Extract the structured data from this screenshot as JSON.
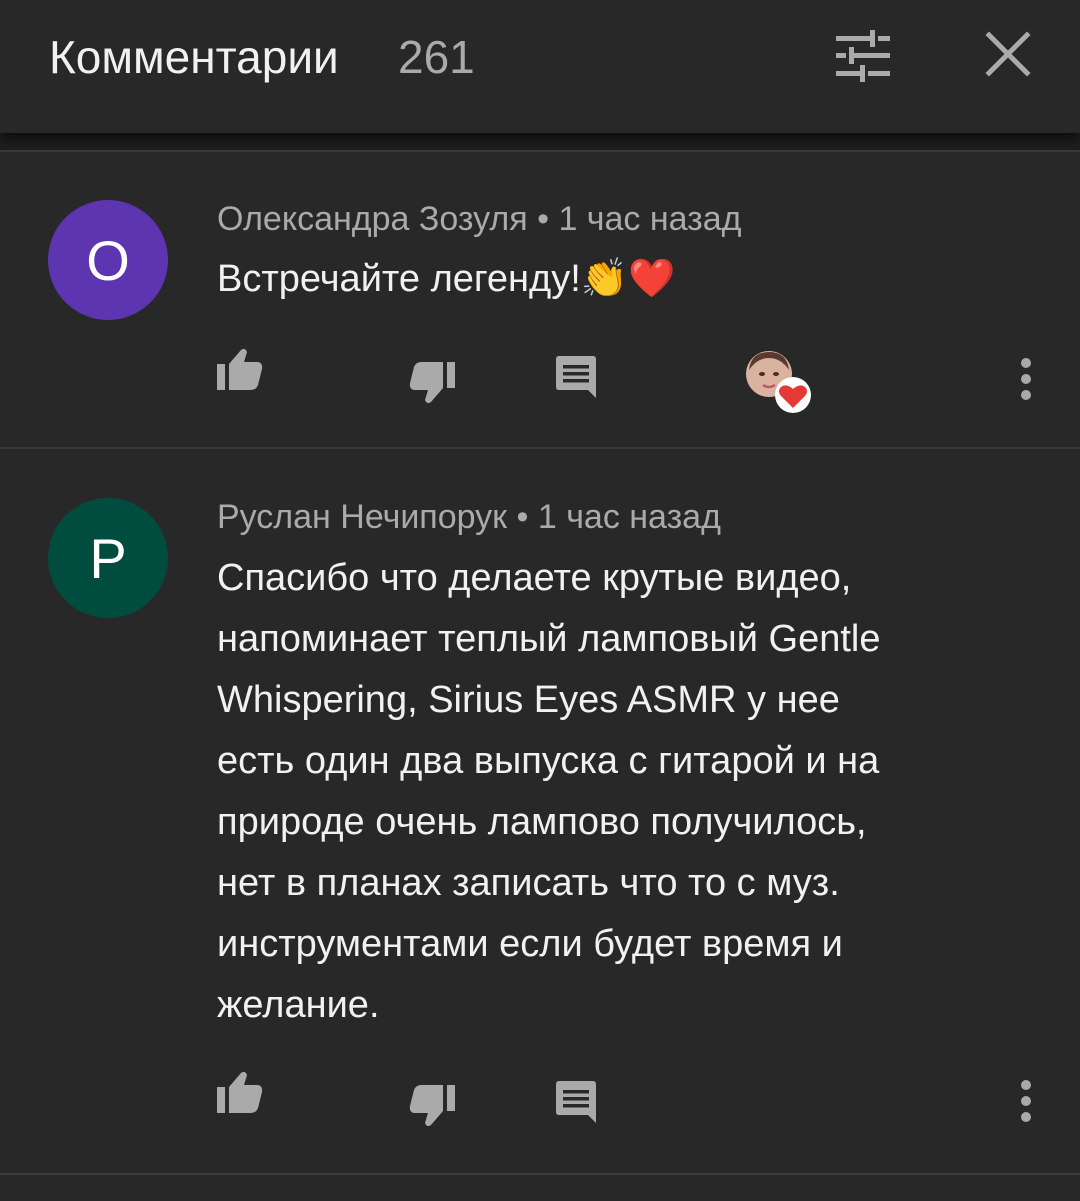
{
  "header": {
    "title": "Комментарии",
    "count": "261",
    "filter_icon": "sort-filter-icon",
    "close_icon": "close-icon"
  },
  "comments": [
    {
      "avatar_letter": "O",
      "avatar_color": "#5e35b1",
      "author": "Олександра Зозуля",
      "separator": "•",
      "time": "1 час назад",
      "text": "Встречайте легенду!",
      "emojis": "👏❤️",
      "hearted_by_creator": true,
      "actions": [
        "like-icon",
        "dislike-icon",
        "reply-icon",
        "creator-heart-icon",
        "more-options-icon"
      ]
    },
    {
      "avatar_letter": "P",
      "avatar_color": "#004d40",
      "author": "Руслан Нечипорук",
      "separator": "•",
      "time": "1 час назад",
      "text": "Спасибо что делаете крутые видео,\nнапоминает теплый ламповый Gentle\nWhispering,  Sirius Eyes ASMR у нее\nесть один два выпуска с гитарой и на\nприроде очень лампово получилось,\nнет в планах записать что то с муз.\nинструментами если будет время и\nжелание.",
      "actions": [
        "like-icon",
        "dislike-icon",
        "reply-icon",
        "more-options-icon"
      ]
    }
  ],
  "colors": {
    "background": "#282828",
    "text_primary": "#f1f1f1",
    "text_secondary": "#aaaaaa",
    "icon": "#aaaaaa",
    "heart": "#e53935"
  }
}
